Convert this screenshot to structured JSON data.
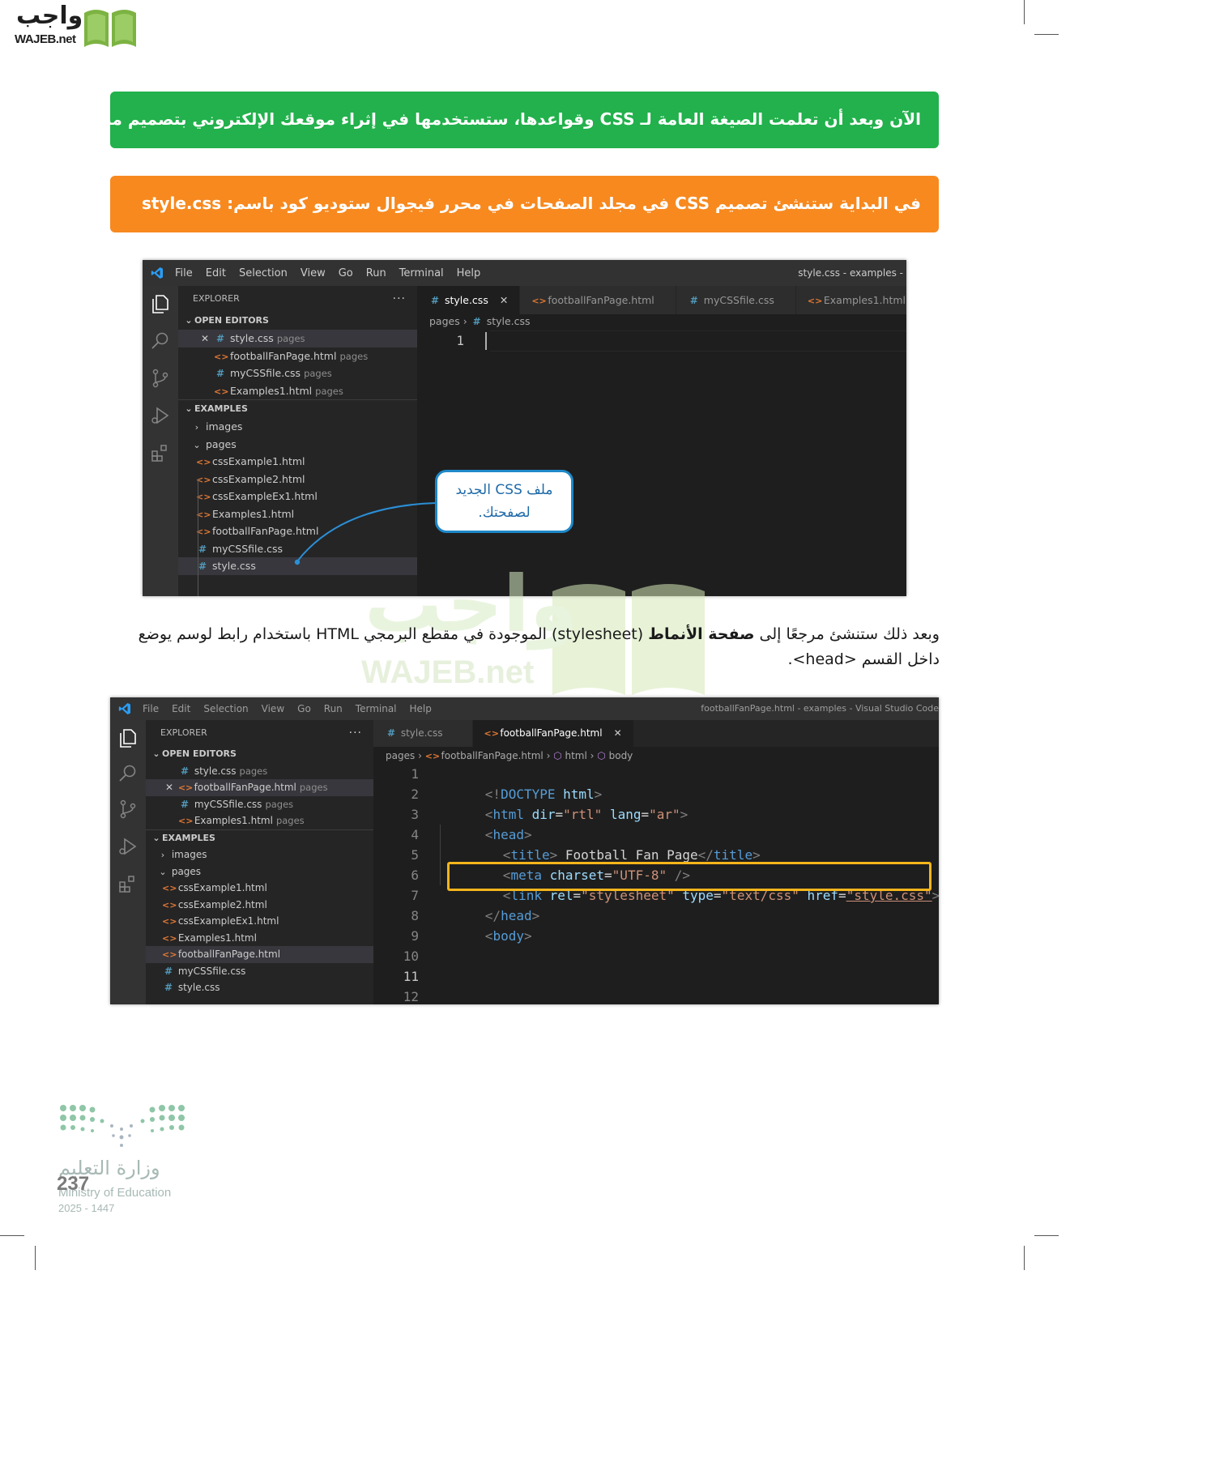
{
  "logo": {
    "ar": "واجب",
    "en": "WAJEB.net"
  },
  "banners": {
    "green": "الآن وبعد أن تعلمت الصيغة العامة لـ CSS وقواعدها، ستستخدمها في إثراء موقعك الإلكتروني بتصميم مناسب.",
    "orange": "في البداية ستنشئ تصميم CSS في مجلد الصفحات في محرر فيجوال ستوديو كود باسم: style.css"
  },
  "paragraph": {
    "part1": "وبعد ذلك ستنشئ مرجعًا إلى ",
    "bold": "صفحة الأنماط",
    "part2": " (stylesheet) الموجودة في مقطع البرمجي HTML باستخدام رابط لوسم يوضع داخل القسم <head>."
  },
  "watermark": {
    "ar": "واجب",
    "en": "WAJEB.net"
  },
  "menu": [
    "File",
    "Edit",
    "Selection",
    "View",
    "Go",
    "Run",
    "Terminal",
    "Help"
  ],
  "win1": {
    "title": "style.css - examples -",
    "explorer": "EXPLORER",
    "dots": "···",
    "open_editors_label": "OPEN EDITORS",
    "open_editors": [
      {
        "name": "style.css",
        "folder": "pages",
        "icon": "css-icon",
        "close": "✕"
      },
      {
        "name": "footballFanPage.html",
        "folder": "pages",
        "icon": "html-icon"
      },
      {
        "name": "myCSSfile.css",
        "folder": "pages",
        "icon": "css-icon"
      },
      {
        "name": "Examples1.html",
        "folder": "pages",
        "icon": "html-icon"
      }
    ],
    "examples_label": "EXAMPLES",
    "folder_images": "images",
    "folder_pages": "pages",
    "files": [
      {
        "name": "cssExample1.html",
        "icon": "html-icon"
      },
      {
        "name": "cssExample2.html",
        "icon": "html-icon"
      },
      {
        "name": "cssExampleEx1.html",
        "icon": "html-icon"
      },
      {
        "name": "Examples1.html",
        "icon": "html-icon"
      },
      {
        "name": "footballFanPage.html",
        "icon": "html-icon"
      },
      {
        "name": "myCSSfile.css",
        "icon": "css-icon"
      },
      {
        "name": "style.css",
        "icon": "css-icon"
      }
    ],
    "tabs": [
      {
        "label": "style.css",
        "icon": "css-icon",
        "active": true,
        "close": "✕"
      },
      {
        "label": "footballFanPage.html",
        "icon": "html-icon"
      },
      {
        "label": "myCSSfile.css",
        "icon": "css-icon"
      },
      {
        "label": "Examples1.html",
        "icon": "html-icon"
      }
    ],
    "breadcrumb": [
      "pages",
      "style.css"
    ],
    "line_numbers": [
      "1"
    ],
    "callout": {
      "line1": "ملف CSS الجديد",
      "line2": "لصفحتك."
    }
  },
  "win2": {
    "title": "footballFanPage.html - examples - Visual Studio Code",
    "explorer": "EXPLORER",
    "dots": "···",
    "open_editors_label": "OPEN EDITORS",
    "open_editors": [
      {
        "name": "style.css",
        "folder": "pages",
        "icon": "css-icon"
      },
      {
        "name": "footballFanPage.html",
        "folder": "pages",
        "icon": "html-icon",
        "close": "✕"
      },
      {
        "name": "myCSSfile.css",
        "folder": "pages",
        "icon": "css-icon"
      },
      {
        "name": "Examples1.html",
        "folder": "pages",
        "icon": "html-icon"
      }
    ],
    "examples_label": "EXAMPLES",
    "folder_images": "images",
    "folder_pages": "pages",
    "files": [
      {
        "name": "cssExample1.html",
        "icon": "html-icon"
      },
      {
        "name": "cssExample2.html",
        "icon": "html-icon"
      },
      {
        "name": "cssExampleEx1.html",
        "icon": "html-icon"
      },
      {
        "name": "Examples1.html",
        "icon": "html-icon"
      },
      {
        "name": "footballFanPage.html",
        "icon": "html-icon"
      },
      {
        "name": "myCSSfile.css",
        "icon": "css-icon"
      },
      {
        "name": "style.css",
        "icon": "css-icon"
      }
    ],
    "tabs": [
      {
        "label": "style.css",
        "icon": "css-icon"
      },
      {
        "label": "footballFanPage.html",
        "icon": "html-icon",
        "active": true,
        "close": "✕"
      }
    ],
    "breadcrumb": [
      "pages",
      "footballFanPage.html",
      "html",
      "body"
    ],
    "line_numbers": [
      "1",
      "2",
      "3",
      "4",
      "5",
      "6",
      "7",
      "8",
      "9",
      "10",
      "11",
      "12"
    ],
    "code": {
      "l1": [
        "<!",
        "DOCTYPE",
        " html",
        ">"
      ],
      "l2": [
        "<",
        "html",
        " dir",
        "=",
        "\"rtl\"",
        " lang",
        "=",
        "\"ar\"",
        ">"
      ],
      "l3": [
        "<",
        "head",
        ">"
      ],
      "l4": [
        "<",
        "title",
        ">",
        " Football Fan Page",
        "</",
        "title",
        ">"
      ],
      "l5": [
        "<",
        "meta",
        " charset",
        "=",
        "\"UTF-8\"",
        " />"
      ],
      "l6": [
        "<",
        "link",
        " rel",
        "=",
        "\"stylesheet\"",
        " type",
        "=",
        "\"text/css\"",
        " href",
        "=",
        "\"style.css\"",
        ">"
      ],
      "l7": [
        "</",
        "head",
        ">"
      ],
      "l8": [
        "<",
        "body",
        ">"
      ]
    }
  },
  "footer": {
    "ministry_ar": "وزارة التعليم",
    "ministry_en": "Ministry of Education",
    "year": "2025 - 1447",
    "page_number": "237"
  },
  "colors": {
    "green_banner": "#22b14c",
    "orange_banner": "#f7891f",
    "highlight": "#f5b51b",
    "callout_border": "#1e88c8"
  }
}
